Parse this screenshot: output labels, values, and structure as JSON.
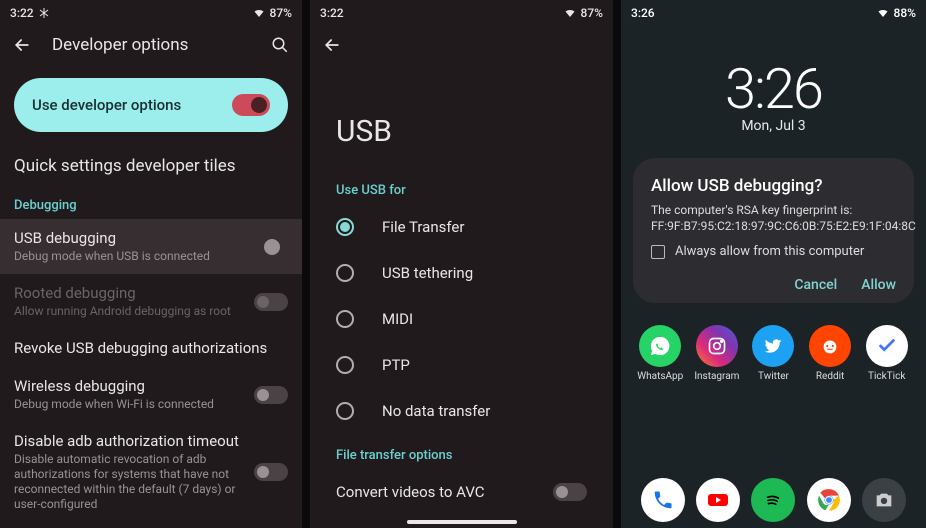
{
  "screen1": {
    "status": {
      "time": "3:22",
      "battery": "87%"
    },
    "header": {
      "title": "Developer options"
    },
    "pill": {
      "label": "Use developer options"
    },
    "section_quick": "Quick settings developer tiles",
    "cat_debug": "Debugging",
    "items": {
      "usb": {
        "title": "USB debugging",
        "sub": "Debug mode when USB is connected"
      },
      "rooted": {
        "title": "Rooted debugging",
        "sub": "Allow running Android debugging as root"
      },
      "revoke": {
        "title": "Revoke USB debugging authorizations"
      },
      "wireless": {
        "title": "Wireless debugging",
        "sub": "Debug mode when Wi-Fi is connected"
      },
      "adb": {
        "title": "Disable adb authorization timeout",
        "sub": "Disable automatic revocation of adb authorizations for systems that have not reconnected within the default (7 days) or user-configured"
      }
    }
  },
  "screen2": {
    "status": {
      "time": "3:22",
      "battery": "87%"
    },
    "title": "USB",
    "cat_usefor": "Use USB for",
    "options": {
      "file": "File Transfer",
      "tether": "USB tethering",
      "midi": "MIDI",
      "ptp": "PTP",
      "none": "No data transfer"
    },
    "cat_ft": "File transfer options",
    "convert": "Convert videos to AVC"
  },
  "screen3": {
    "status": {
      "time": "3:26",
      "battery": "88%"
    },
    "clock": {
      "time": "3:26",
      "date": "Mon, Jul 3"
    },
    "dialog": {
      "title": "Allow USB debugging?",
      "body1": "The computer's RSA key fingerprint is:",
      "body2": "FF:9F:B7:95:C2:18:97:9C:C6:0B:75:E2:E9:1F:04:8C",
      "checkbox": "Always allow from this computer",
      "cancel": "Cancel",
      "allow": "Allow"
    },
    "apps": {
      "whatsapp": "WhatsApp",
      "instagram": "Instagram",
      "twitter": "Twitter",
      "reddit": "Reddit",
      "ticktick": "TickTick"
    }
  }
}
